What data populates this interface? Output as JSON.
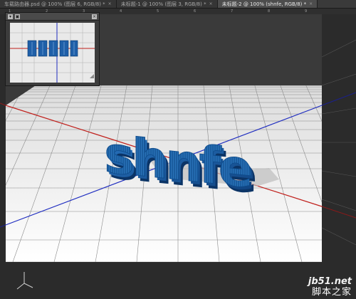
{
  "tabs": [
    {
      "label": "车载路由器.psd @ 100% (图层 6, RGB/8) *",
      "active": false
    },
    {
      "label": "未标题-1 @ 100% (图层 3, RGB/8) *",
      "active": false
    },
    {
      "label": "未标题-2 @ 100% (shnfe, RGB/8) *",
      "active": true
    }
  ],
  "tab_close_glyph": "×",
  "ruler_top_marks": [
    "1",
    "2",
    "3",
    "4",
    "5",
    "6",
    "7",
    "8",
    "9"
  ],
  "ruler_left_marks": [
    "1",
    "2",
    "3",
    "4",
    "5",
    "6",
    "7"
  ],
  "navigator": {
    "close_glyph": "×",
    "pin_glyph": "▣",
    "expand_glyph": "▾"
  },
  "scene": {
    "text_3d": "shnfe",
    "text_color": "#1f6fb8",
    "x_axis_color": "#c0201c",
    "z_axis_color": "#1e2cc0",
    "ground_color": "#ffffff",
    "grid_color": "#8a8a8a"
  },
  "watermark": {
    "domain": "jb51.net",
    "name": "脚本之家"
  }
}
